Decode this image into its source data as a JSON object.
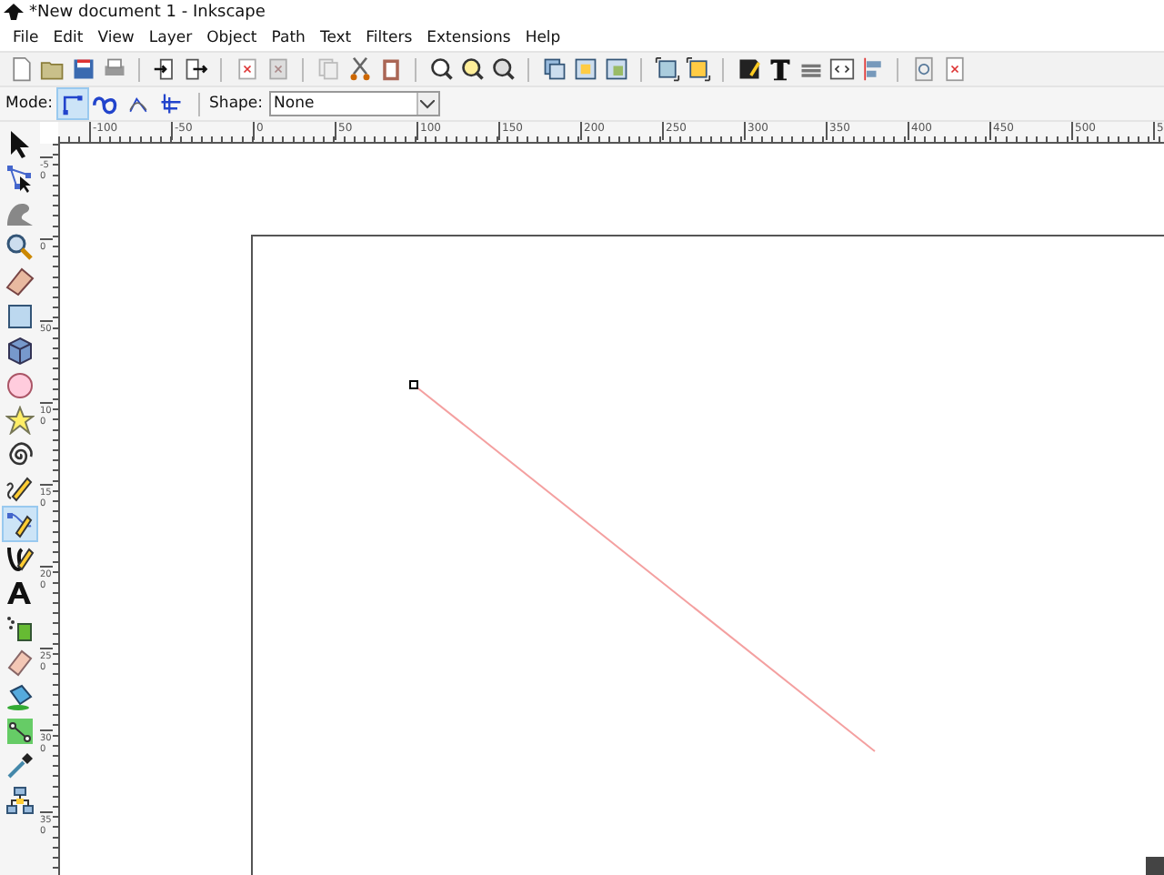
{
  "window": {
    "title": "*New document 1 - Inkscape"
  },
  "menu": [
    "File",
    "Edit",
    "View",
    "Layer",
    "Object",
    "Path",
    "Text",
    "Filters",
    "Extensions",
    "Help"
  ],
  "tool_controls": {
    "mode_label": "Mode:",
    "modes": [
      {
        "selected": true
      },
      {
        "selected": false
      },
      {
        "selected": false
      },
      {
        "selected": false
      }
    ],
    "shape_label": "Shape:",
    "shape_value": "None"
  },
  "toolbox": [
    {
      "selected": false
    },
    {
      "selected": false
    },
    {
      "selected": false
    },
    {
      "selected": false
    },
    {
      "selected": false
    },
    {
      "selected": false
    },
    {
      "selected": false
    },
    {
      "selected": false
    },
    {
      "selected": false
    },
    {
      "selected": false
    },
    {
      "selected": false
    },
    {
      "selected": true
    },
    {
      "selected": false
    },
    {
      "selected": false
    },
    {
      "selected": false
    },
    {
      "selected": false
    },
    {
      "selected": false
    },
    {
      "selected": false
    },
    {
      "selected": false
    },
    {
      "selected": false
    }
  ],
  "horizontal_ruler": [
    "-100",
    "-50",
    "0",
    "50",
    "100",
    "150",
    "200",
    "250",
    "300",
    "350",
    "400",
    "450",
    "500",
    "5"
  ],
  "vertical_ruler": [
    "-50",
    "0",
    "50",
    "100",
    "150",
    "200",
    "250",
    "300",
    "350"
  ]
}
